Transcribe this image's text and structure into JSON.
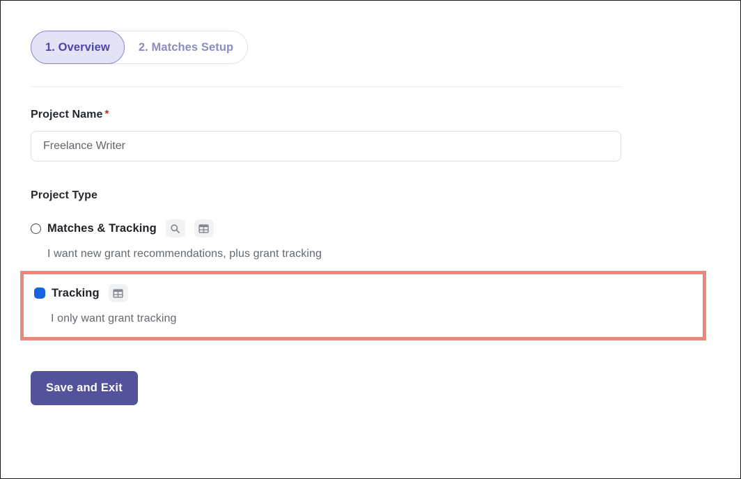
{
  "tabs": [
    {
      "label": "1. Overview",
      "active": true
    },
    {
      "label": "2. Matches Setup",
      "active": false
    }
  ],
  "form": {
    "project_name": {
      "label": "Project Name",
      "required_marker": "*",
      "value": "Freelance Writer",
      "placeholder": "Project Name"
    },
    "project_type": {
      "label": "Project Type",
      "options": [
        {
          "title": "Matches & Tracking",
          "description": "I want new grant recommendations, plus grant tracking",
          "selected": false,
          "icons": [
            "search-icon",
            "table-icon"
          ]
        },
        {
          "title": "Tracking",
          "description": "I only want grant tracking",
          "selected": true,
          "icons": [
            "table-icon"
          ]
        }
      ]
    }
  },
  "actions": {
    "save_and_exit": "Save and Exit"
  },
  "colors": {
    "accent_purple": "#54529b",
    "tab_active_bg": "#e4e3f5",
    "tab_active_text": "#4b46a8",
    "tab_inactive_text": "#8e8bbd",
    "radio_selected": "#1663e0",
    "highlight_border": "#e8897b",
    "required_star": "#b32b2b",
    "icon_grey": "#7c848e",
    "badge_bg": "#f1f2f4"
  }
}
